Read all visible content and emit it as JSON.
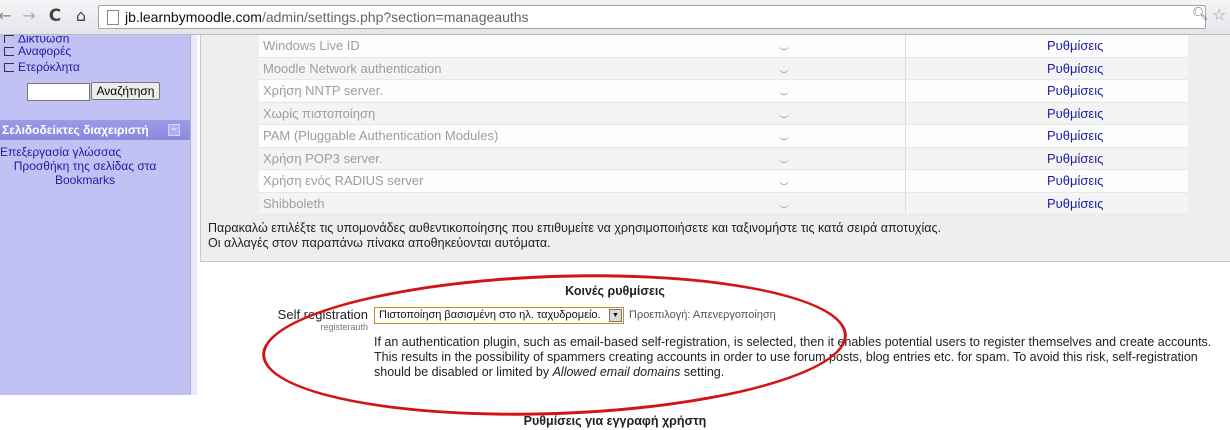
{
  "browser": {
    "url_host": "jb.learnbymoodle.com",
    "url_path": "/admin/settings.php?section=manageauths"
  },
  "sidebar": {
    "links": [
      "Δίκτυωση",
      "Αναφορές",
      "Ετερόκλητα"
    ],
    "search_button": "Αναζήτηση",
    "bookmarks_block": {
      "title": "Σελιδοδείκτες διαχειριστή",
      "edit_language": "Επεξεργασία γλώσσας",
      "add_page_line1": "Προσθήκη της σελίδας στα",
      "add_page_line2": "Bookmarks"
    }
  },
  "auth_table": {
    "rows": [
      {
        "name": "Windows Live ID",
        "settings": "Ρυθμίσεις"
      },
      {
        "name": "Moodle Network authentication",
        "settings": "Ρυθμίσεις"
      },
      {
        "name": "Χρήση NNTP server.",
        "settings": "Ρυθμίσεις"
      },
      {
        "name": "Χωρίς πιστοποίηση",
        "settings": "Ρυθμίσεις"
      },
      {
        "name": "PAM (Pluggable Authentication Modules)",
        "settings": "Ρυθμίσεις"
      },
      {
        "name": "Χρήση POP3 server.",
        "settings": "Ρυθμίσεις"
      },
      {
        "name": "Χρήση ενός RADIUS server",
        "settings": "Ρυθμίσεις"
      },
      {
        "name": "Shibboleth",
        "settings": "Ρυθμίσεις"
      }
    ],
    "note_line1": "Παρακαλώ επιλέξτε τις υπομονάδες αυθεντικοποίησης που επιθυμείτε να χρησιμοποιήσετε και ταξινομήστε τις κατά σειρά αποτυχίας.",
    "note_line2": "Οι αλλαγές στον παραπάνω πίνακα αποθηκεύονται αυτόματα."
  },
  "common_settings": {
    "title": "Κοινές ρυθμίσεις",
    "self_registration": {
      "label": "Self registration",
      "sublabel": "registerauth",
      "selected": "Πιστοποίηση βασισμένη στο ηλ. ταχυδρομείο.",
      "default": "Προεπιλογή: Απενεργοποίηση",
      "description": "If an authentication plugin, such as email-based self-registration, is selected, then it enables potential users to register themselves and create accounts. This results in the possibility of spammers creating accounts in order to use forum posts, blog entries etc. for spam. To avoid this risk, self-registration should be disabled or limited by",
      "description_em": "Allowed email domains",
      "description_end": "setting."
    }
  },
  "user_signup_section": {
    "title": "Ρυθμίσεις για εγγραφή χρήστη"
  },
  "colors": {
    "sidebar_bg": "#c1c1f3",
    "link": "#1c1ca8",
    "annotation": "#d21414"
  }
}
